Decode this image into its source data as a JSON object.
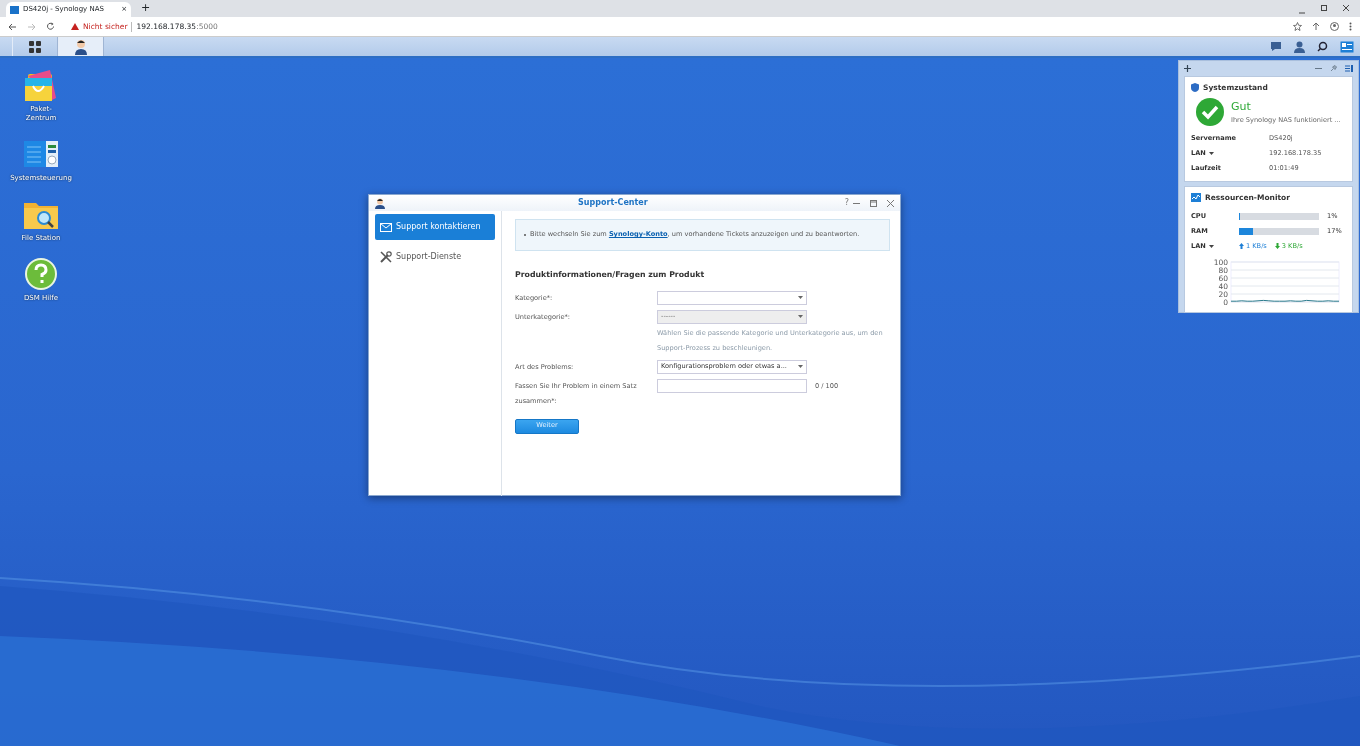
{
  "browser": {
    "tab_title": "DS420j - Synology NAS",
    "tab_close": "×",
    "new_tab": "+",
    "security": "Nicht sicher",
    "url_host": "192.168.178.35",
    "url_port": ":5000"
  },
  "taskbar": {
    "buttons": [
      {
        "kind": "apps",
        "selected": false
      },
      {
        "kind": "support",
        "selected": true
      }
    ]
  },
  "desktop_icons": [
    {
      "kind": "package",
      "label_lines": [
        "Paket-",
        "Zentrum"
      ]
    },
    {
      "kind": "control",
      "label_lines": [
        "Systemsteuerung"
      ]
    },
    {
      "kind": "folder",
      "label_lines": [
        "File Station"
      ]
    },
    {
      "kind": "help",
      "label_lines": [
        "DSM Hilfe"
      ]
    }
  ],
  "window": {
    "title": "Support-Center",
    "help": "?",
    "sidebar": {
      "items": [
        {
          "kind": "mail",
          "label": "Support kontaktieren",
          "selected": true
        },
        {
          "kind": "tools",
          "label": "Support-Dienste",
          "selected": false
        }
      ]
    },
    "notice": {
      "before": "Bitte wechseln Sie zum ",
      "link": "Synology-Konto",
      "after": ", um vorhandene Tickets anzuzeigen und zu beantworten."
    },
    "section_title": "Produktinformationen/Fragen zum Produkt",
    "fields": [
      {
        "kind": "select",
        "label": "Kategorie*:",
        "disabled": false
      },
      {
        "kind": "select",
        "label": "Unterkategorie*:",
        "value": "------",
        "disabled": true,
        "hint": "Wählen Sie die passende Kategorie und Unterkategorie aus, um den Support-Prozess zu beschleunigen."
      },
      {
        "kind": "select",
        "label": "Art des Problems:",
        "value": "Konfigurationsproblem oder etwas a...",
        "disabled": false
      },
      {
        "kind": "input",
        "label": "Fassen Sie Ihr Problem in einem Satz zusammen*:",
        "counter": "0 / 100"
      }
    ],
    "button": "Weiter"
  },
  "widgets": {
    "system": {
      "title": "Systemzustand",
      "status": "Gut",
      "message": "Ihre Synology NAS funktioniert ...",
      "rows": [
        {
          "label": "Servername",
          "value": "DS420j",
          "dropdown": false
        },
        {
          "label": "LAN",
          "value": "192.168.178.35",
          "dropdown": true
        },
        {
          "label": "Laufzeit",
          "value": "01:01:49",
          "dropdown": false
        }
      ]
    },
    "resources": {
      "title": "Ressourcen-Monitor",
      "meters": [
        {
          "label": "CPU",
          "level": 0.01,
          "reading": "1%"
        },
        {
          "label": "RAM",
          "level": 0.17,
          "reading": "17%"
        }
      ],
      "lan": {
        "label": "LAN",
        "upload": "1 KB/s",
        "download": "3 KB/s"
      },
      "chart_data": {
        "type": "line",
        "ylim": [
          0,
          100
        ],
        "yticks": [
          0,
          20,
          40,
          60,
          80,
          100
        ],
        "grid": true,
        "series": [
          {
            "color": "#2a7a8c",
            "values": [
              2,
              2,
              3,
              2,
              2,
              3,
              4,
              3,
              2,
              2,
              2,
              3,
              2,
              2,
              4,
              3,
              2,
              2,
              3,
              2,
              2
            ]
          }
        ]
      }
    }
  }
}
